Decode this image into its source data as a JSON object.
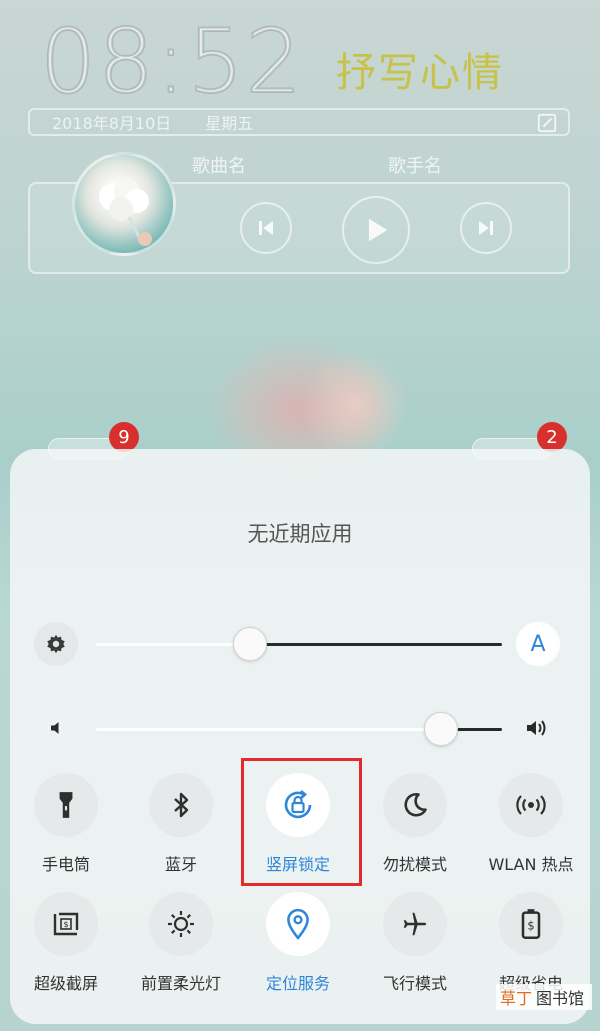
{
  "lockscreen": {
    "time": "08:52",
    "mood_text": "抒写心情",
    "date": "2018年8月10日",
    "weekday": "星期五"
  },
  "music": {
    "song_label": "歌曲名",
    "artist_label": "歌手名"
  },
  "notifications": {
    "left_badge": "9",
    "right_badge": "2"
  },
  "panel": {
    "recent_apps_empty": "无近期应用",
    "brightness": {
      "level": 0.38,
      "auto_label": "A"
    },
    "volume": {
      "level": 0.85
    }
  },
  "toggles_row1": [
    {
      "label": "手电筒",
      "icon": "flashlight-icon",
      "active": false
    },
    {
      "label": "蓝牙",
      "icon": "bluetooth-icon",
      "active": false
    },
    {
      "label": "竖屏锁定",
      "icon": "rotation-lock-icon",
      "active": true
    },
    {
      "label": "勿扰模式",
      "icon": "moon-icon",
      "active": false
    },
    {
      "label": "WLAN 热点",
      "icon": "hotspot-icon",
      "active": false
    }
  ],
  "toggles_row2": [
    {
      "label": "超级截屏",
      "icon": "screenshot-icon",
      "active": false
    },
    {
      "label": "前置柔光灯",
      "icon": "sun-icon",
      "active": false
    },
    {
      "label": "定位服务",
      "icon": "location-pin-icon",
      "active": true
    },
    {
      "label": "飞行模式",
      "icon": "airplane-icon",
      "active": false
    },
    {
      "label": "超级省电",
      "icon": "battery-icon",
      "active": false
    }
  ],
  "watermark": {
    "part_a": "草丁",
    "part_b": "图书馆"
  },
  "colors": {
    "accent": "#2f86d8",
    "highlight_box": "#e42a2a",
    "badge": "#d8312d"
  }
}
